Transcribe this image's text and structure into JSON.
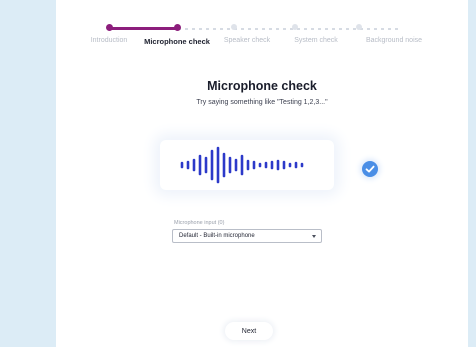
{
  "stepper": {
    "progress_color": "#8c1e7c",
    "current_index": 1,
    "steps": [
      {
        "label": "Introduction"
      },
      {
        "label": "Microphone check"
      },
      {
        "label": "Speaker check"
      },
      {
        "label": "System check"
      },
      {
        "label": "Background noise"
      }
    ]
  },
  "main": {
    "title": "Microphone check",
    "subtitle": "Try saying something like \"Testing 1,2,3...\"",
    "status_icon": "checkmark-circle-icon",
    "accent_color": "#4a8ee6",
    "wave_color": "#2c39c9",
    "microphone_field": {
      "label": "Microphone input (0)",
      "selected": "Default - Built-in microphone"
    }
  },
  "footer": {
    "next_label": "Next"
  }
}
